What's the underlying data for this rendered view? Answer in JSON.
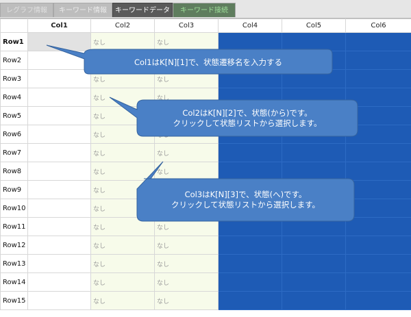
{
  "tabs": [
    "レグラフ情報",
    "キーワード情報",
    "キーワードデータ",
    "キーワード接続"
  ],
  "columns": [
    "Col1",
    "Col2",
    "Col3",
    "Col4",
    "Col5",
    "Col6"
  ],
  "rows": [
    "Row1",
    "Row2",
    "Row3",
    "Row4",
    "Row5",
    "Row6",
    "Row7",
    "Row8",
    "Row9",
    "Row10",
    "Row11",
    "Row12",
    "Row13",
    "Row14",
    "Row15"
  ],
  "cell_placeholder": "なし",
  "callouts": [
    {
      "text": "Col1はK[N][1]で、状態遷移名を入力する"
    },
    {
      "line1": "Col2はK[N][2]で、状態(から)です。",
      "line2": "クリックして状態リストから選択します。"
    },
    {
      "line1": "Col3はK[N][3]で、状態(へ)です。",
      "line2": "クリックして状態リストから選択します。"
    }
  ],
  "colors": {
    "accent_blue": "#1e5bb5",
    "callout_fill": "#4a80c6",
    "cell_fill": "#f7fbea"
  }
}
